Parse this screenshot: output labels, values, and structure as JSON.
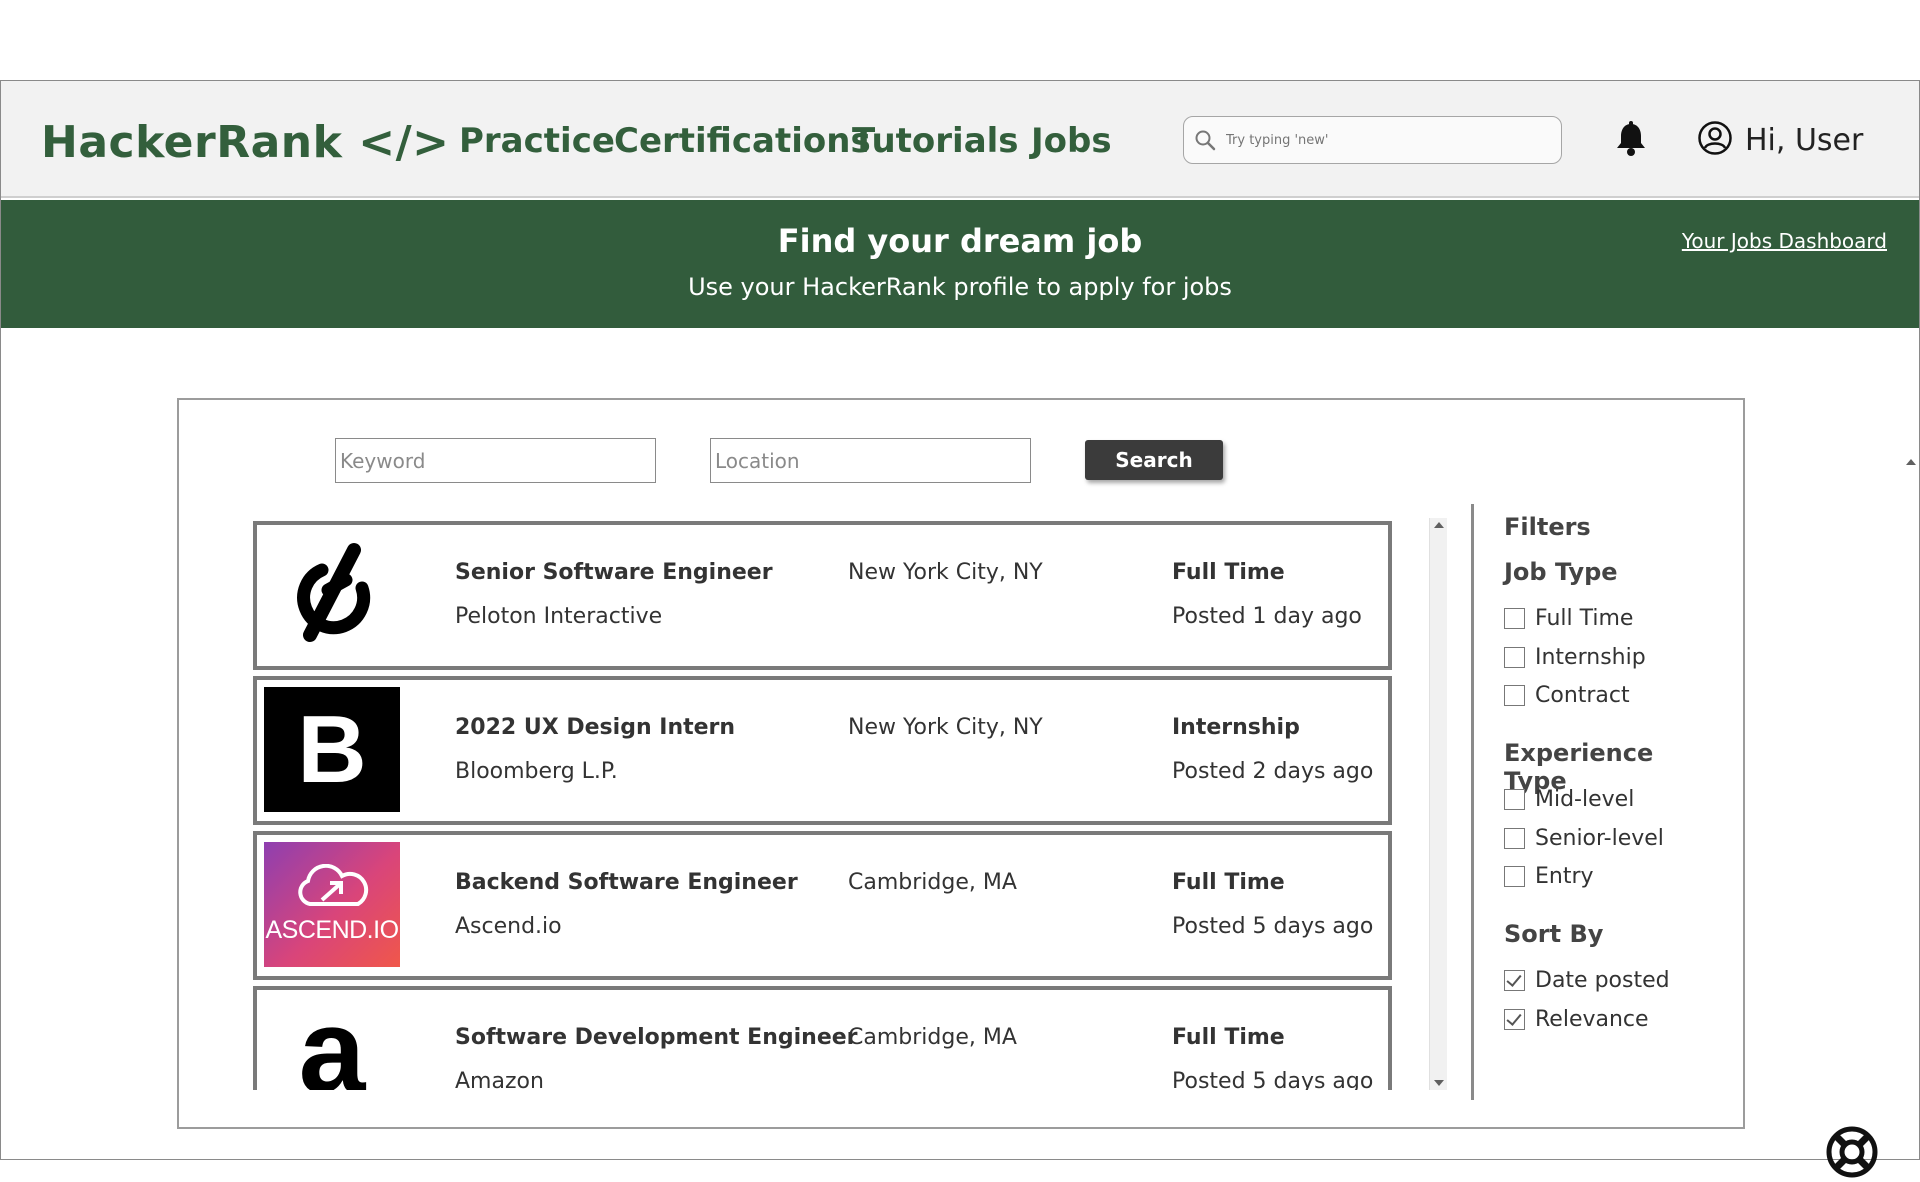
{
  "header": {
    "logo": "HackerRank </>",
    "nav": [
      "Practice",
      "Certifications",
      "Tutorials",
      "Jobs"
    ],
    "search_placeholder": "Try typing 'new'",
    "user_greeting": "Hi, User"
  },
  "banner": {
    "title": "Find your dream job",
    "subtitle": "Use your HackerRank profile to apply for jobs",
    "dashboard_link": "Your Jobs Dashboard"
  },
  "search": {
    "keyword_placeholder": "Keyword",
    "location_placeholder": "Location",
    "button": "Search"
  },
  "jobs": [
    {
      "title": "Senior Software Engineer",
      "company": "Peloton Interactive",
      "location": "New York City, NY",
      "type": "Full Time",
      "posted": "Posted 1 day ago",
      "logo": "peloton-logo"
    },
    {
      "title": "2022 UX Design Intern",
      "company": "Bloomberg L.P.",
      "location": "New York City, NY",
      "type": "Internship",
      "posted": "Posted 2 days ago",
      "logo": "bloomberg-logo",
      "logo_text": "B"
    },
    {
      "title": "Backend Software Engineer",
      "company": "Ascend.io",
      "location": "Cambridge, MA",
      "type": "Full Time",
      "posted": "Posted 5 days ago",
      "logo": "ascend-logo",
      "logo_text": "ASCEND.IO"
    },
    {
      "title": "Software Development Engineer",
      "company": "Amazon",
      "location": "Cambridge, MA",
      "type": "Full Time",
      "posted": "Posted 5 days ago",
      "logo": "amazon-logo",
      "logo_text": "a"
    }
  ],
  "filters": {
    "heading": "Filters",
    "job_type": {
      "heading": "Job Type",
      "options": [
        {
          "label": "Full Time",
          "checked": false
        },
        {
          "label": "Internship",
          "checked": false
        },
        {
          "label": "Contract",
          "checked": false
        }
      ]
    },
    "experience_type": {
      "heading": "Experience Type",
      "options": [
        {
          "label": "Mid-level",
          "checked": false
        },
        {
          "label": "Senior-level",
          "checked": false
        },
        {
          "label": "Entry",
          "checked": false
        }
      ]
    },
    "sort_by": {
      "heading": "Sort By",
      "options": [
        {
          "label": "Date posted",
          "checked": true
        },
        {
          "label": "Relevance",
          "checked": true
        }
      ]
    }
  },
  "colors": {
    "brand_green": "#335f3c",
    "banner_green": "#325c3c",
    "button_dark": "#3b3b3b"
  },
  "icons": [
    "search-icon",
    "bell-icon",
    "user-icon",
    "help-lifebuoy-icon"
  ]
}
